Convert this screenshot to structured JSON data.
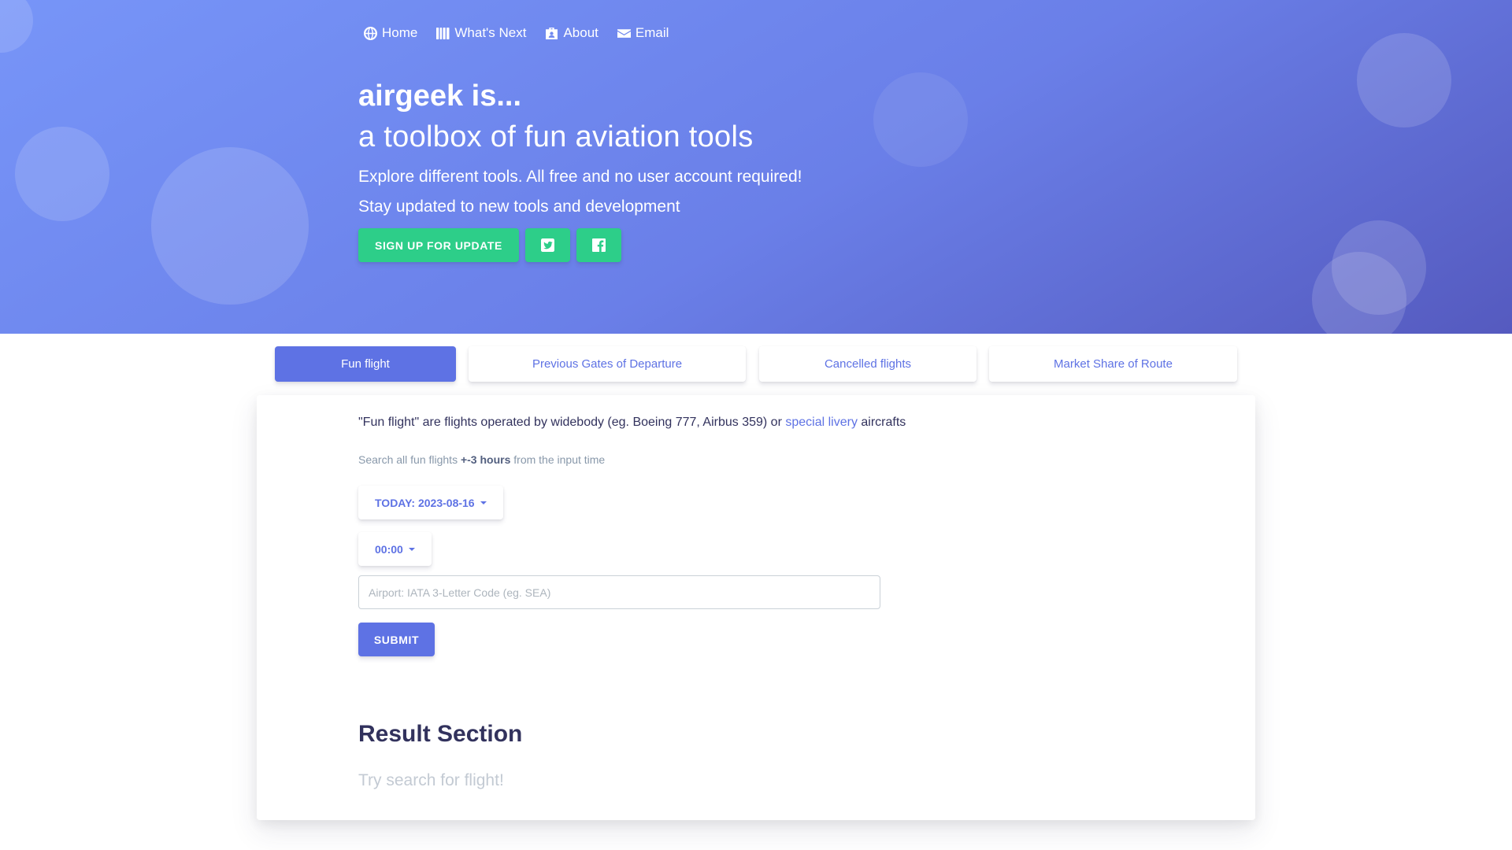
{
  "nav": {
    "items": [
      {
        "label": "Home",
        "icon": "globe-icon"
      },
      {
        "label": "What's Next",
        "icon": "columns-icon"
      },
      {
        "label": "About",
        "icon": "id-badge-icon"
      },
      {
        "label": "Email",
        "icon": "envelope-icon"
      }
    ]
  },
  "hero": {
    "title": "airgeek is...",
    "subtitle": "a toolbox of fun aviation tools",
    "lead1": "Explore different tools. All free and no user account required!",
    "lead2": "Stay updated to new tools and development",
    "signup_label": "Sign up for update",
    "twitter_icon": "twitter-icon",
    "facebook_icon": "facebook-icon"
  },
  "tabs": [
    {
      "label": "Fun flight",
      "active": true
    },
    {
      "label": "Previous Gates of Departure",
      "active": false
    },
    {
      "label": "Cancelled flights",
      "active": false
    },
    {
      "label": "Market Share of Route",
      "active": false
    }
  ],
  "form": {
    "intro_before": "\"Fun flight\" are flights operated by widebody (eg. Boeing 777, Airbus 359) or ",
    "intro_link": "special livery",
    "intro_after": " aircrafts",
    "hint_before": "Search all fun flights ",
    "hint_strong": "+-3 hours",
    "hint_after": " from the input time",
    "date_label": "TODAY: 2023-08-16",
    "time_label": "00:00",
    "airport_placeholder": "Airport: IATA 3-Letter Code (eg. SEA)",
    "airport_value": "",
    "submit_label": "Submit"
  },
  "result": {
    "title": "Result Section",
    "empty_text": "Try search for flight!"
  },
  "colors": {
    "primary": "#5e72e4",
    "success": "#2dce89",
    "hero_start": "#7795f8",
    "hero_end": "#555abf"
  }
}
